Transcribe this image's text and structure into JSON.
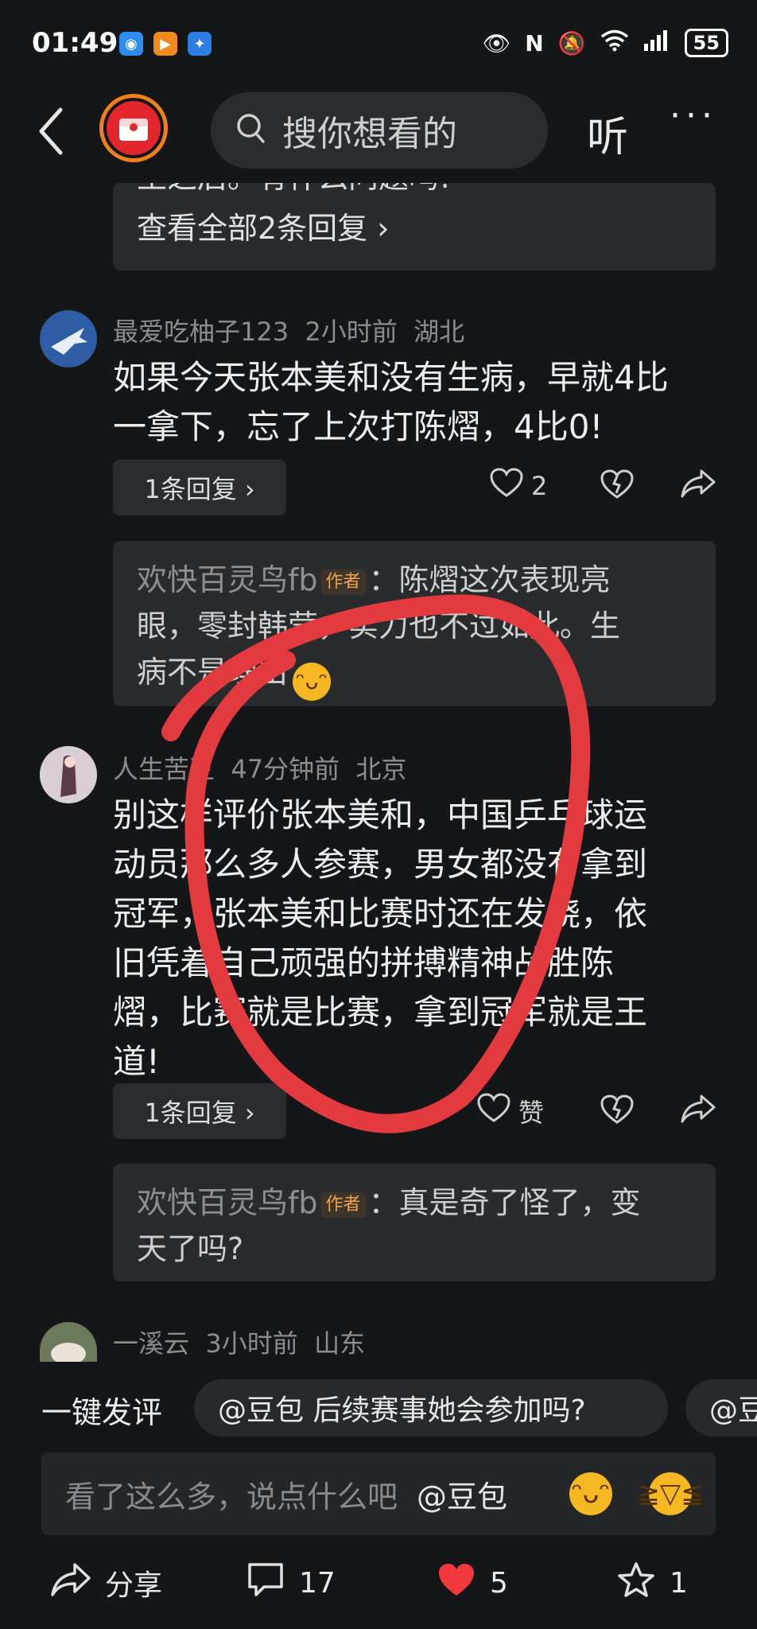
{
  "status_bar": {
    "time": "01:49",
    "battery": "55",
    "icons": [
      "eye-icon",
      "nfc-icon",
      "mute-icon",
      "wifi-icon",
      "signal-icon",
      "battery-icon"
    ]
  },
  "top_bar": {
    "search_placeholder": "搜你想看的",
    "listen_label": "听",
    "more_label": "···"
  },
  "top_card": {
    "cut_text": "王之后。有什么问题吗!",
    "view_all": "查看全部2条回复 ›"
  },
  "comments": [
    {
      "user": "最爱吃柚子123",
      "time": "2小时前",
      "location": "湖北",
      "lines": [
        "如果今天张本美和没有生病，早就4比",
        "一拿下，忘了上次打陈熠，4比0!"
      ],
      "reply_count": "1条回复 ›",
      "likes": "2",
      "reply": {
        "name": "欢快百灵鸟fb",
        "tag": "作者",
        "line1": "：陈熠这次表现亮",
        "line2": "眼，零封韩莹，实力也不过如此。生",
        "line3": "病不是理由"
      }
    },
    {
      "user": "人生苦豆",
      "time": "47分钟前",
      "location": "北京",
      "lines": [
        "别这样评价张本美和，中国乒乓球运",
        "动员那么多人参赛，男女都没有拿到",
        "冠军，张本美和比赛时还在发烧，依",
        "旧凭着自己顽强的拼搏精神战胜陈",
        "熠，比赛就是比赛，拿到冠军就是王",
        "道!"
      ],
      "reply_count": "1条回复 ›",
      "likes": "赞",
      "reply": {
        "name": "欢快百灵鸟fb",
        "tag": "作者",
        "line1": "：真是奇了怪了，变",
        "line2": "天了吗?"
      }
    },
    {
      "user": "一溪云",
      "time": "3小时前",
      "location": "山东"
    }
  ],
  "quick_comment": {
    "label": "一键发评",
    "chips": [
      "@豆包 后续赛事她会参加吗?",
      "@豆"
    ]
  },
  "input": {
    "placeholder": "看了这么多，说点什么吧",
    "at_label": "@豆包"
  },
  "bottom_bar": {
    "share": "分享",
    "comments": "17",
    "likes": "5",
    "favorites": "1"
  },
  "colors": {
    "background": "#151617",
    "accent_red": "#e3262c",
    "annotation_red": "#e23a3f",
    "author_tag": "#f0a24c"
  }
}
